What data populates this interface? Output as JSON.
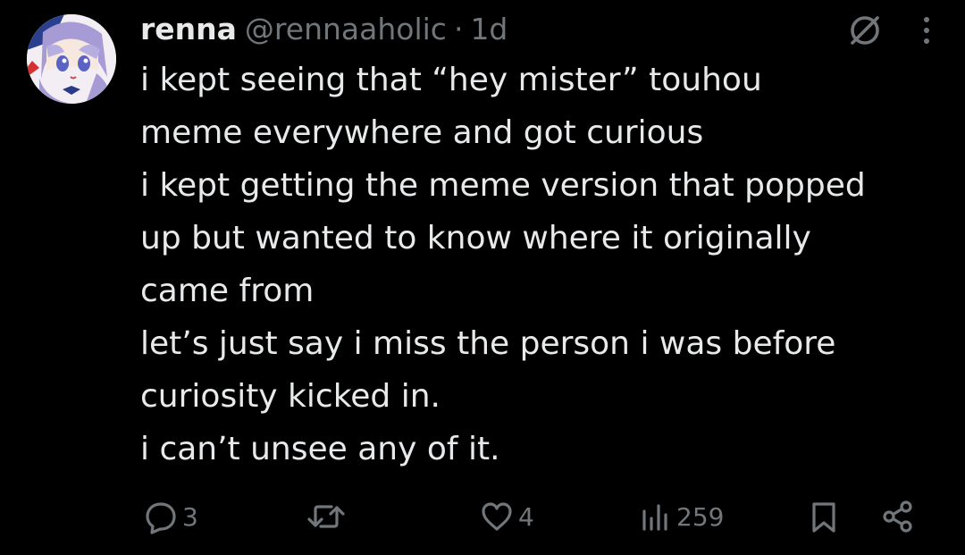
{
  "author": {
    "name": "renna",
    "handle": "@rennaaholic",
    "separator": "·",
    "time": "1d"
  },
  "tweet": {
    "lines": [
      "i kept seeing that “hey mister” touhou",
      "meme everywhere and got curious",
      "i kept getting the meme version that popped",
      "up but wanted to know where it originally",
      "came from",
      "let’s just say i miss the person i was before",
      "curiosity kicked in.",
      "i can’t unsee any of it."
    ]
  },
  "actions": {
    "reply": {
      "icon": "reply-icon",
      "count": "3"
    },
    "retweet": {
      "icon": "retweet-icon",
      "count": ""
    },
    "like": {
      "icon": "heart-icon",
      "count": "4"
    },
    "views": {
      "icon": "views-icon",
      "count": "259"
    },
    "bookmark": {
      "icon": "bookmark-icon"
    },
    "share": {
      "icon": "share-icon"
    }
  },
  "colors": {
    "background": "#000000",
    "text": "#e7e9ea",
    "secondary": "#71767b"
  }
}
